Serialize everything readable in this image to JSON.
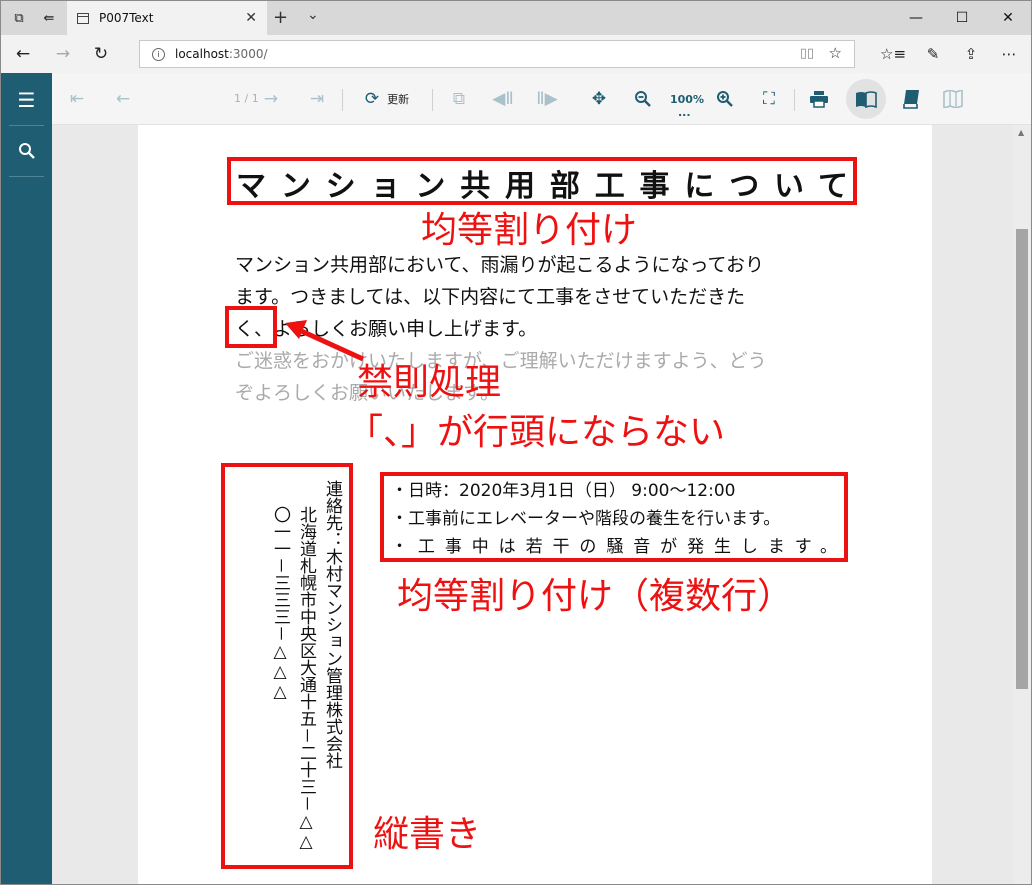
{
  "browser": {
    "tab_title": "P007Text",
    "tab_close": "✕",
    "new_tab": "+",
    "tab_menu": "⌄",
    "window_controls": {
      "minimize": "—",
      "maximize": "☐",
      "close": "✕"
    },
    "url_host": "localhost",
    "url_path": ":3000/",
    "nav_icons": [
      "back-icon",
      "forward-icon",
      "refresh-icon"
    ],
    "toolbar_icons": [
      "favorites-icon",
      "pen-icon",
      "share-icon",
      "more-icon"
    ]
  },
  "viewer": {
    "page_indicator": "1 / 1",
    "refresh_label": "更新",
    "zoom_level": "100%",
    "zoom_sub": "...",
    "accent_color": "#1f5d72"
  },
  "document": {
    "title": "マンション共用部工事について",
    "paragraph": [
      "マンション共用部において、雨漏りが起こるようになっており",
      "ます。つきましては、以下内容にて工事をさせていただきた",
      "く、よろしくお願い申し上げます。",
      "ご迷惑をおかけいたしますが、ご理解いただけますよう、どう",
      "ぞよろしくお願いいたします。"
    ],
    "bullets": [
      "・日時：2020年3月1日（日） 9:00～12:00",
      "・工事前にエレベーターや階段の養生を行います。",
      "・工事中は若干の騒音が発生します。"
    ],
    "vertical_lines": [
      "連絡先：木村マンション管理株式会社",
      "北海道札幌市中央区大通十五－二十三－△△",
      "〇一一－三三三－△△△"
    ]
  },
  "annotations": {
    "title_note": "均等割り付け",
    "kinsoku_note": "禁則処理",
    "kinsoku_detail": "「、」が行頭にならない",
    "bullets_note": "均等割り付け（複数行）",
    "vertical_note": "縦書き",
    "color": "#ee1111"
  }
}
